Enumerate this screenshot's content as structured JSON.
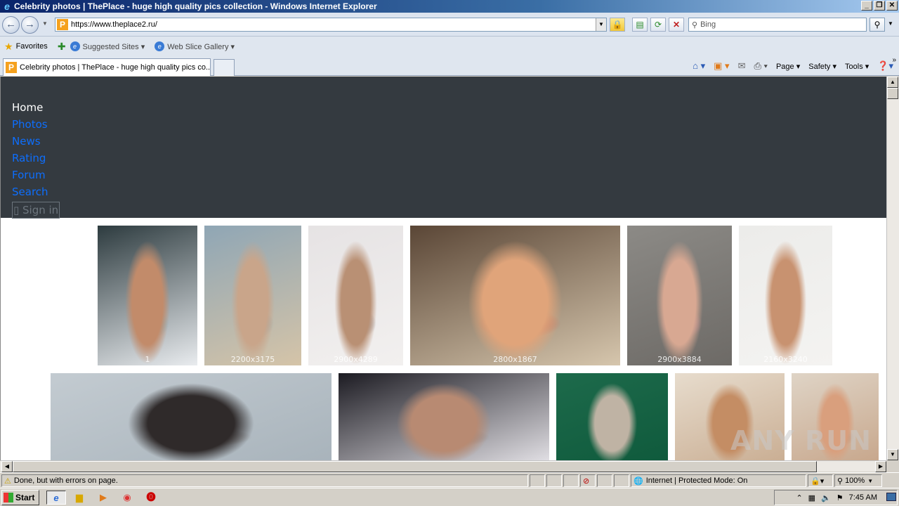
{
  "window": {
    "title": "Celebrity photos | ThePlace - huge high quality pics collection - Windows Internet Explorer"
  },
  "address": {
    "url": "https://www.theplace2.ru/",
    "search_placeholder": "Bing"
  },
  "favorites_bar": {
    "favorites_label": "Favorites",
    "suggested_sites": "Suggested Sites ▾",
    "web_slice_gallery": "Web Slice Gallery ▾"
  },
  "tab": {
    "title": "Celebrity photos | ThePlace - huge high quality pics co..."
  },
  "command_bar": {
    "page": "Page ▾",
    "safety": "Safety ▾",
    "tools": "Tools ▾"
  },
  "site_nav": {
    "home": "Home",
    "photos": "Photos",
    "news": "News",
    "rating": "Rating",
    "forum": "Forum",
    "search": "Search",
    "sign_in": "▯ Sign in"
  },
  "photos": [
    {
      "dims": "1",
      "colors": [
        "#2d3b3f",
        "#e9ecef",
        "#c28b6a",
        "#4fb5d6"
      ]
    },
    {
      "dims": "2200x3175",
      "colors": [
        "#8fa6b5",
        "#d5c4a8",
        "#c9a58a",
        "#7c93a0"
      ]
    },
    {
      "dims": "2900x4289",
      "colors": [
        "#e6e3e4",
        "#f2f0ef",
        "#b99074",
        "#5a5560"
      ]
    },
    {
      "dims": "2800x1867",
      "colors": [
        "#5a4636",
        "#d6c6ad",
        "#e0a47a",
        "#d73a2a"
      ]
    },
    {
      "dims": "2900x3884",
      "colors": [
        "#8c8a86",
        "#6d6a66",
        "#d8a892",
        "#e58fa9"
      ]
    },
    {
      "dims": "2160x3240",
      "colors": [
        "#ececea",
        "#f4f3f1",
        "#c89270",
        "#f6f5f3"
      ]
    },
    {
      "dims": "",
      "colors": [
        "#c3cbd1",
        "#a8b3bb",
        "#2f2a2a",
        "#6d625a"
      ]
    },
    {
      "dims": "",
      "colors": [
        "#1c1b22",
        "#e5e3e8",
        "#b88a72",
        "#7a6e6a"
      ]
    },
    {
      "dims": "",
      "colors": [
        "#1d6a4b",
        "#0f5a3c",
        "#bfb3a4",
        "#4b3a33"
      ]
    },
    {
      "dims": "",
      "colors": [
        "#e7dccd",
        "#c9ad92",
        "#c48d64",
        "#b5a79a"
      ]
    },
    {
      "dims": "",
      "colors": [
        "#dfd4c6",
        "#c7a68b",
        "#d99f7d",
        "#8e7a6b"
      ]
    }
  ],
  "status": {
    "text": "Done, but with errors on page.",
    "zone": "Internet | Protected Mode: On",
    "zoom": "100%"
  },
  "taskbar": {
    "start": "Start",
    "clock": "7:45 AM"
  },
  "watermark": "ANY RUN"
}
